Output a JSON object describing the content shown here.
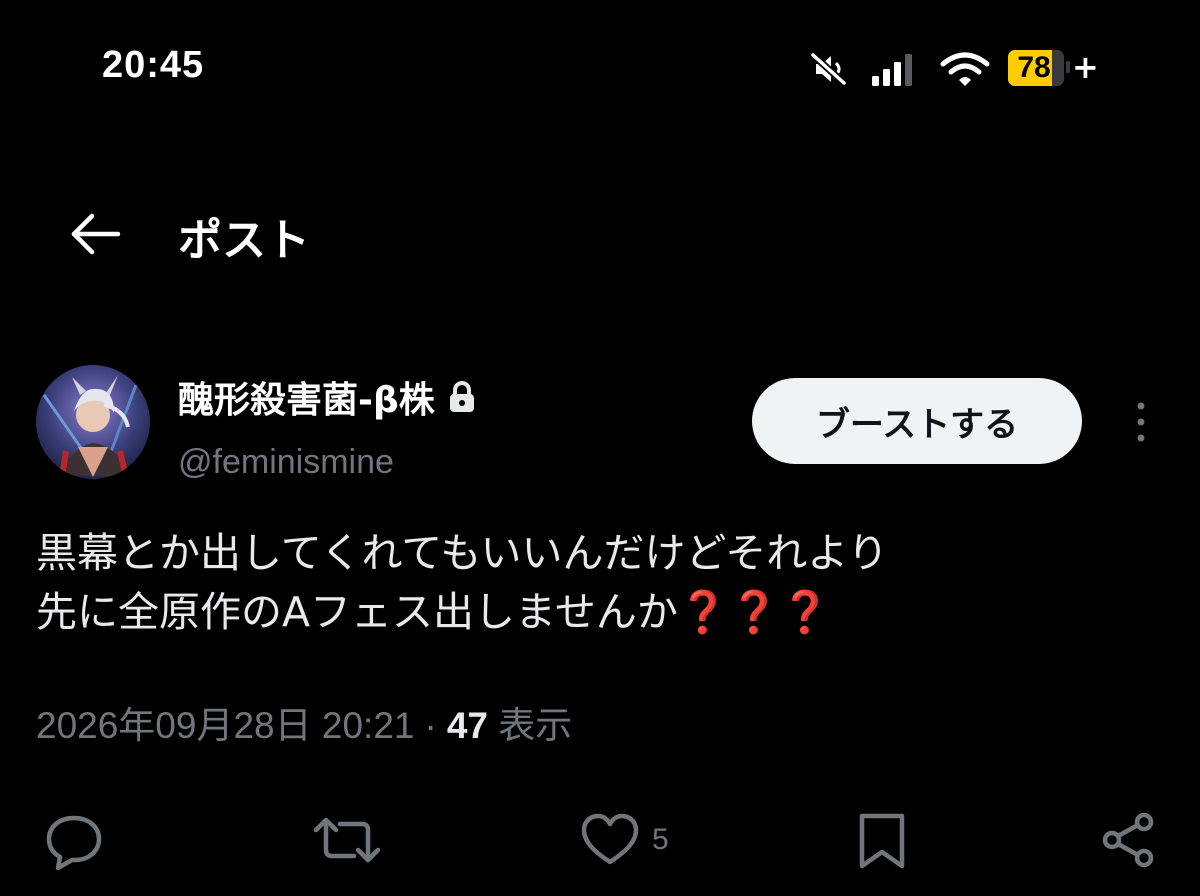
{
  "status_bar": {
    "time": "20:45",
    "battery_level": 78,
    "battery_label": "78",
    "charging_symbol": "+",
    "icons": [
      "mute-icon",
      "signal-icon",
      "wifi-icon",
      "battery-icon"
    ],
    "battery_color": "#ffcc00"
  },
  "header": {
    "title": "ポスト",
    "back_icon": "arrow-left-icon"
  },
  "post": {
    "display_name": "醜形殺害菌-β株",
    "protected_icon": "lock-icon",
    "handle": "@feminismine",
    "boost_label": "ブーストする",
    "text_line1": "黒幕とか出してくれてもいいんだけどそれより",
    "text_line2": "先に全原作のAフェス出しませんか",
    "text_emphasis": "❓❓❓",
    "timestamp": "2026年09月28日 20:21",
    "separator": "·",
    "views_count": "47",
    "views_label": "表示"
  },
  "actions": {
    "reply_icon": "reply-icon",
    "repost_icon": "repost-icon",
    "like_icon": "heart-icon",
    "like_count": "5",
    "bookmark_icon": "bookmark-icon",
    "share_icon": "share-icon"
  },
  "colors": {
    "background": "#000000",
    "primary_text": "#e7e9ea",
    "secondary_text": "#71767b",
    "button_bg": "#eff3f4",
    "emphasis_red": "#e0312b"
  }
}
